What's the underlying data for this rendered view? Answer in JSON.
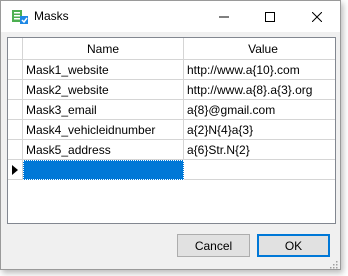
{
  "window": {
    "title": "Masks",
    "controls": {
      "minimize": "minimize",
      "maximize": "maximize",
      "close": "close"
    }
  },
  "grid": {
    "columns": [
      "Name",
      "Value"
    ],
    "rows": [
      {
        "name": "Mask1_website",
        "value": "http://www.a{10}.com"
      },
      {
        "name": "Mask2_website",
        "value": "http://www.a{8}.a{3}.org"
      },
      {
        "name": "Mask3_email",
        "value": "a{8}@gmail.com"
      },
      {
        "name": "Mask4_vehicleidnumber",
        "value": "a{2}N{4}a{3}"
      },
      {
        "name": "Mask5_address",
        "value": "a{6}Str.N{2}"
      }
    ],
    "new_row": {
      "name": "",
      "value": ""
    }
  },
  "buttons": {
    "cancel": "Cancel",
    "ok": "OK"
  },
  "colors": {
    "selection": "#0078d7",
    "button_face": "#e1e1e1",
    "grid_line": "#d5d5d5"
  }
}
